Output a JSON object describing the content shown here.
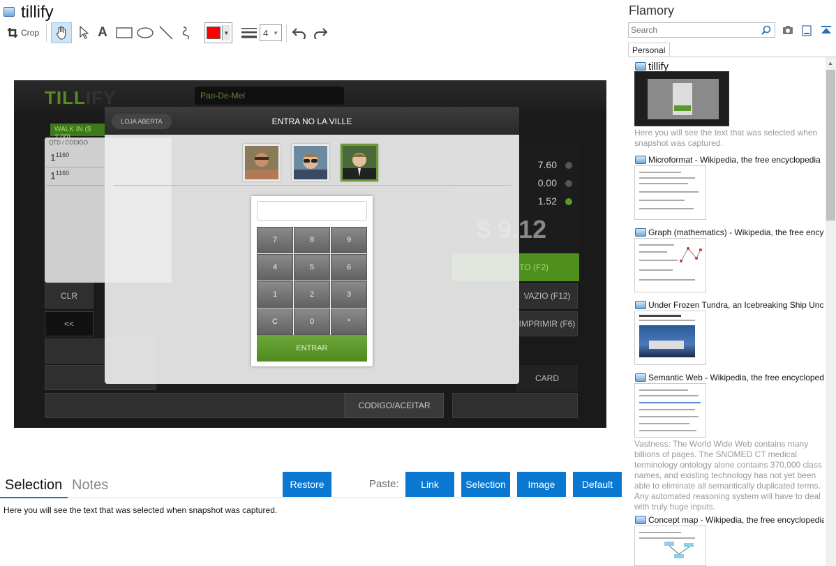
{
  "window": {
    "title": "tillify"
  },
  "toolbar": {
    "crop_label": "Crop",
    "line_width": "4",
    "color": "#ff0000"
  },
  "snapshot": {
    "logo_a": "TILL",
    "logo_b": "IFY",
    "search_value": "Pao-De-Mel",
    "walk_in": "WALK IN ($ 2.00)",
    "ticket_header": "QTD / CODIGO",
    "ticket_lines": [
      {
        "qty": "1",
        "code": "1160"
      },
      {
        "qty": "1",
        "code": "1160"
      }
    ],
    "totals": [
      "7.60",
      "0.00",
      "1.52"
    ],
    "big_total": "$ 9.12",
    "green_button": "TO (F2)",
    "buttons": {
      "clr": "CLR",
      "back": "<<",
      "vazio": "VAZIO (F12)",
      "imprimir": "IMPRIMIR (F6)",
      "card": "CARD",
      "codigo": "CODIGO/ACEITAR"
    },
    "modal": {
      "loja": "LOJA ABERTA",
      "title": "ENTRA NO LA VILLE",
      "keys": [
        "7",
        "8",
        "9",
        "4",
        "5",
        "6",
        "1",
        "2",
        "3",
        "C",
        "0",
        "*"
      ],
      "enter": "ENTRAR"
    }
  },
  "bottom": {
    "tabs": [
      "Selection",
      "Notes"
    ],
    "restore": "Restore",
    "paste_label": "Paste:",
    "paste_buttons": [
      "Link",
      "Selection",
      "Image",
      "Default"
    ],
    "selection_text": "Here you will see the text that was selected when snapshot was captured."
  },
  "sidebar": {
    "title": "Flamory",
    "search_placeholder": "Search",
    "tab": "Personal",
    "items": [
      {
        "title": "tillify",
        "note": "Here you will see the text that was selected when snapshot was captured."
      },
      {
        "title": "Microformat - Wikipedia, the free encyclopedia"
      },
      {
        "title": "Graph (mathematics) - Wikipedia, the free ency"
      },
      {
        "title": "Under Frozen Tundra, an Icebreaking Ship Unco"
      },
      {
        "title": "Semantic Web - Wikipedia, the free encycloped",
        "note": "Vastness: The World Wide Web contains many billions of pages. The SNOMED CT medical terminology ontology alone contains 370,000 class names, and existing technology has not yet been able to eliminate all semantically duplicated terms. Any automated reasoning system will have to deal with truly huge inputs."
      },
      {
        "title": "Concept map - Wikipedia, the free encyclopedia"
      }
    ]
  }
}
